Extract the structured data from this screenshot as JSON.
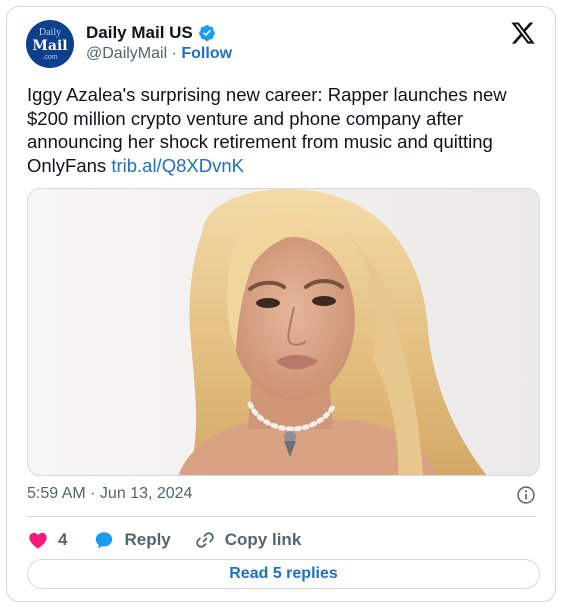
{
  "account": {
    "avatar_lines": [
      "Daily",
      "Mail",
      ".com"
    ],
    "display_name": "Daily Mail US",
    "handle": "@DailyMail",
    "separator": "·",
    "follow_label": "Follow"
  },
  "tweet": {
    "text": "Iggy Azalea's surprising new career: Rapper launches new $200 million crypto venture and phone company after announcing her shock retirement from music and quitting OnlyFans ",
    "link_text": "trib.al/Q8XDvnK",
    "timestamp": "5:59 AM · Jun 13, 2024"
  },
  "actions": {
    "like_count": "4",
    "reply_label": "Reply",
    "copy_label": "Copy link"
  },
  "footer": {
    "read_replies_label": "Read 5 replies"
  },
  "colors": {
    "link_blue": "#1d70c4",
    "like_red": "#f91880",
    "verified_blue": "#1d9bf0",
    "muted_gray": "#536471"
  },
  "icons": {
    "close": "x-logo-icon",
    "verified": "verified-badge-icon",
    "info": "info-icon",
    "like": "heart-icon",
    "reply": "reply-bubble-icon",
    "copy": "link-icon"
  }
}
